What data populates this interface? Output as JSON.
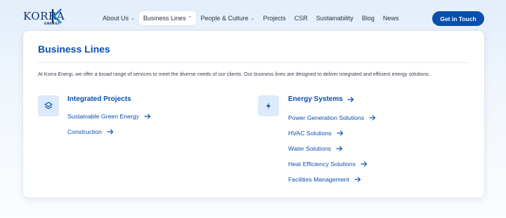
{
  "brand": {
    "logo_word": "KORRA",
    "logo_sub": "ENERGI"
  },
  "nav": {
    "items": [
      {
        "label": "About Us",
        "has_dropdown": true,
        "active": false
      },
      {
        "label": "Business Lines",
        "has_dropdown": true,
        "active": true
      },
      {
        "label": "People & Culture",
        "has_dropdown": true,
        "active": false
      },
      {
        "label": "Projects",
        "has_dropdown": false,
        "active": false
      },
      {
        "label": "CSR",
        "has_dropdown": false,
        "active": false
      },
      {
        "label": "Sustainability",
        "has_dropdown": false,
        "active": false
      },
      {
        "label": "Blog",
        "has_dropdown": false,
        "active": false
      },
      {
        "label": "News",
        "has_dropdown": false,
        "active": false
      }
    ],
    "cta_label": "Get in Touch"
  },
  "panel": {
    "title": "Business Lines",
    "description": "At Korra Energi, we offer a broad range of services to meet the diverse needs of our clients. Our business lines are designed to deliver integrated and efficient energy solutions.",
    "groups": [
      {
        "title": "Integrated Projects",
        "icon": "layers-icon",
        "links": [
          "Sustainable Green Energy",
          "Construction"
        ]
      },
      {
        "title": "Energy Systems",
        "icon": "lightning-icon",
        "links": [
          "Power Generation Solutions",
          "HVAC Solutions",
          "Water Solutions",
          "Heat Efficiency Solutions",
          "Facilities Management"
        ]
      }
    ]
  },
  "colors": {
    "accent": "#0a4fae",
    "icon_bg": "#dceafc",
    "logo": "#0b2d6b"
  }
}
